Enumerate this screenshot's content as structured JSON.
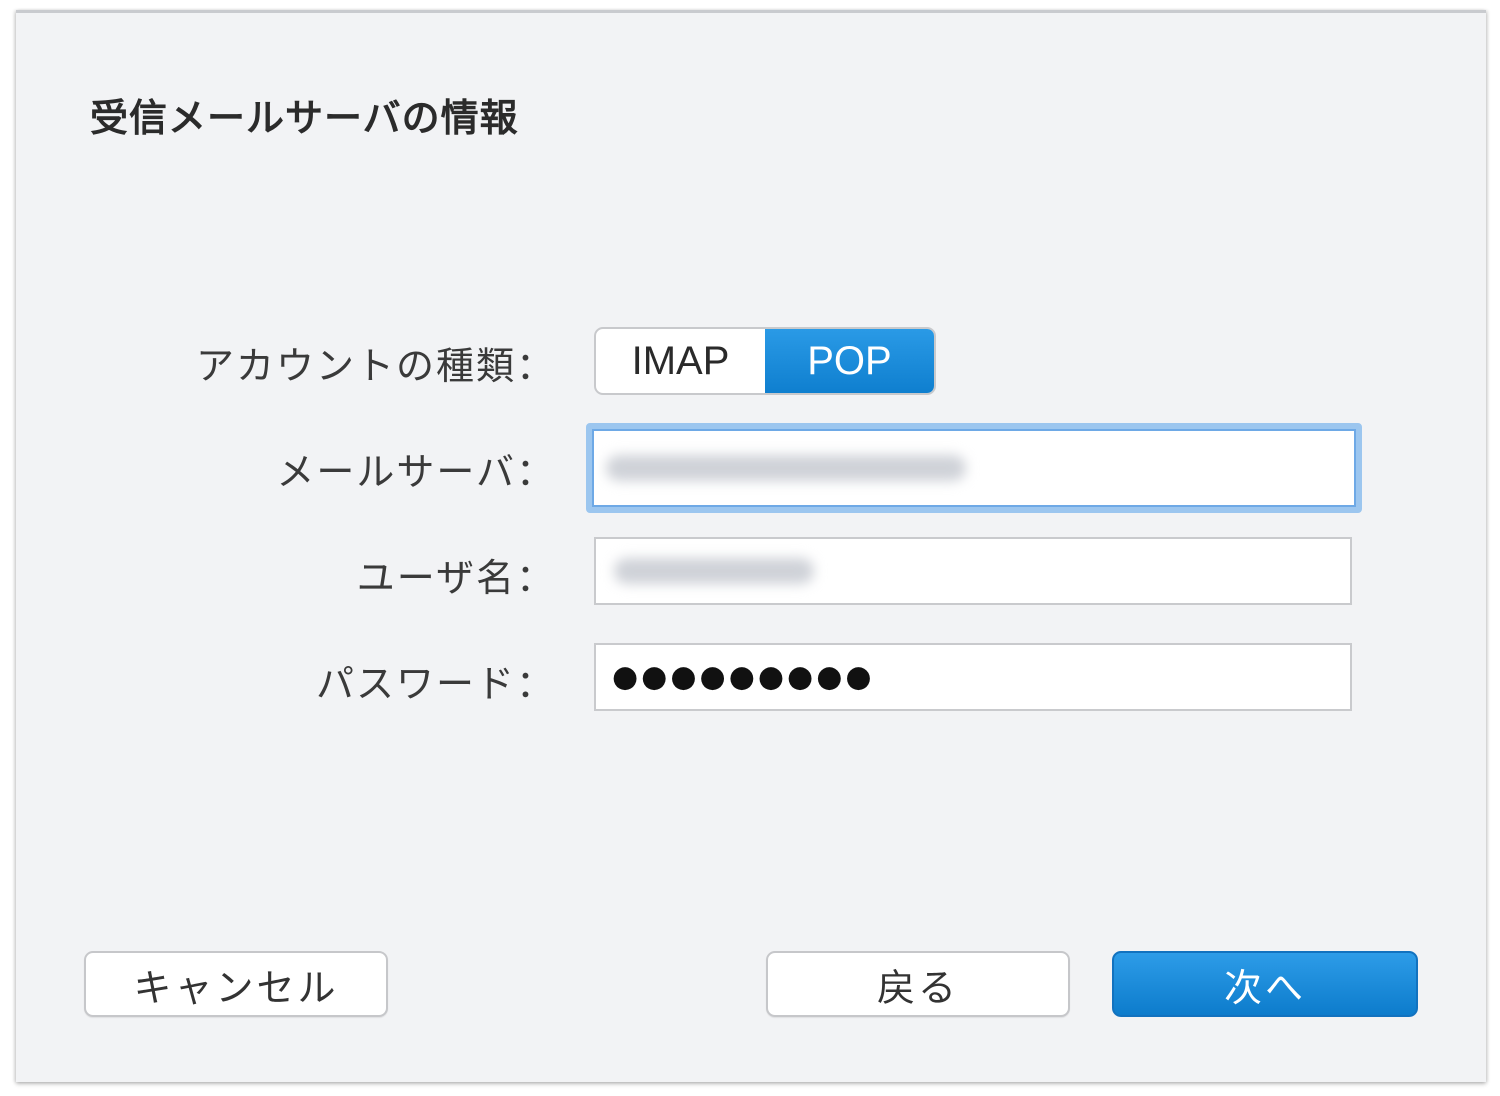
{
  "dialog": {
    "title": "受信メールサーバの情報"
  },
  "form": {
    "account_type_label": "アカウントの種類：",
    "account_type_options": [
      "IMAP",
      "POP"
    ],
    "account_type_selected": "POP",
    "mail_server_label": "メールサーバ：",
    "username_label": "ユーザ名：",
    "password_label": "パスワード：",
    "password_value": "●●●●●●●●●"
  },
  "buttons": {
    "cancel": "キャンセル",
    "back": "戻る",
    "next": "次へ"
  },
  "colors": {
    "accent": "#1583d6",
    "focus_ring": "#9cc6ef",
    "dialog_bg": "#f2f3f5"
  }
}
